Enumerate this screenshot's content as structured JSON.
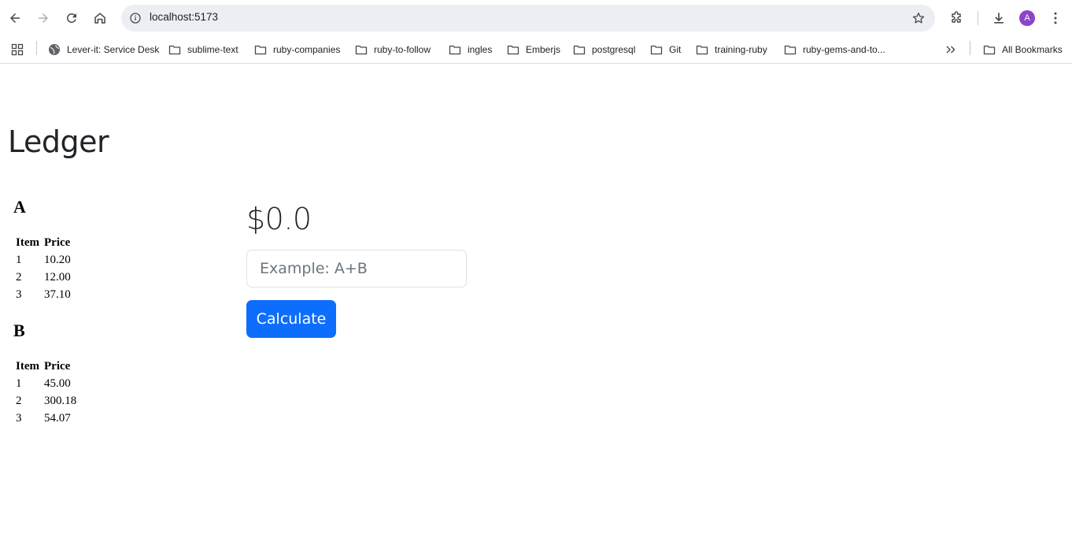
{
  "browser": {
    "url": "localhost:5173",
    "avatar_initial": "A",
    "bookmarks": [
      {
        "label": "Lever-it: Service Desk",
        "icon": "globe-icon"
      },
      {
        "label": "sublime-text",
        "icon": "folder-icon"
      },
      {
        "label": "ruby-companies",
        "icon": "folder-icon"
      },
      {
        "label": "ruby-to-follow",
        "icon": "folder-icon"
      },
      {
        "label": "ingles",
        "icon": "folder-icon"
      },
      {
        "label": "Emberjs",
        "icon": "folder-icon"
      },
      {
        "label": "postgresql",
        "icon": "folder-icon"
      },
      {
        "label": "Git",
        "icon": "folder-icon"
      },
      {
        "label": "training-ruby",
        "icon": "folder-icon"
      },
      {
        "label": "ruby-gems-and-to...",
        "icon": "folder-icon"
      }
    ],
    "all_bookmarks_label": "All Bookmarks"
  },
  "page": {
    "title": "Ledger",
    "ledgers": [
      {
        "name": "A",
        "headers": {
          "item": "Item",
          "price": "Price"
        },
        "rows": [
          {
            "item": "1",
            "price": "10.20"
          },
          {
            "item": "2",
            "price": "12.00"
          },
          {
            "item": "3",
            "price": "37.10"
          }
        ]
      },
      {
        "name": "B",
        "headers": {
          "item": "Item",
          "price": "Price"
        },
        "rows": [
          {
            "item": "1",
            "price": "45.00"
          },
          {
            "item": "2",
            "price": "300.18"
          },
          {
            "item": "3",
            "price": "54.07"
          }
        ]
      }
    ],
    "calculator": {
      "total": "$0.0",
      "input_value": "",
      "input_placeholder": "Example: A+B",
      "button_label": "Calculate",
      "button_color": "#0d6efd"
    }
  }
}
